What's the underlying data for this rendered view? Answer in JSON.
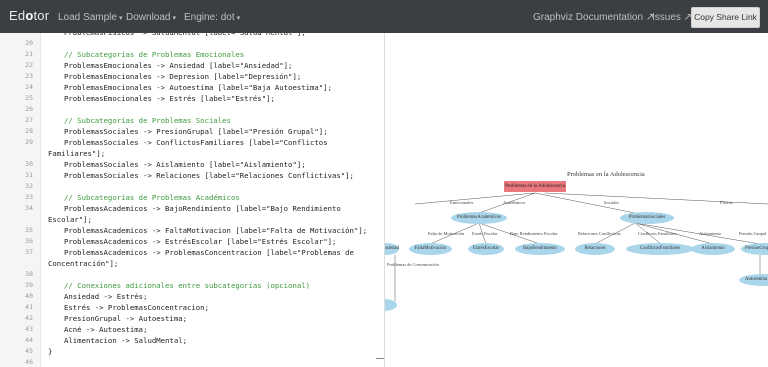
{
  "app": {
    "brand_left": "Ed",
    "brand_mid": "o",
    "brand_right": "tor"
  },
  "nav": {
    "load_sample": "Load Sample",
    "download": "Download",
    "engine": "Engine: dot",
    "graphviz_docs": "Graphviz Documentation ↗",
    "issues": "Issues ↗",
    "copy_share": "Copy Share Link"
  },
  "editor": {
    "lines": [
      {
        "n": "",
        "text": "ProblemasFisicos -> SaludMental [label=\"Salud Mental\"];"
      },
      {
        "n": "20",
        "text": ""
      },
      {
        "n": "21",
        "text": "// Subcategorías de Problemas Emocionales"
      },
      {
        "n": "22",
        "text": "ProblemasEmocionales -> Ansiedad [label=\"Ansiedad\"];"
      },
      {
        "n": "23",
        "text": "ProblemasEmocionales -> Depresion [label=\"Depresión\"];"
      },
      {
        "n": "24",
        "text": "ProblemasEmocionales -> Autoestima [label=\"Baja Autoestima\"];"
      },
      {
        "n": "25",
        "text": "ProblemasEmocionales -> Estrés [label=\"Estrés\"];"
      },
      {
        "n": "26",
        "text": ""
      },
      {
        "n": "27",
        "text": "// Subcategorías de Problemas Sociales"
      },
      {
        "n": "28",
        "text": "ProblemasSociales -> PresionGrupal [label=\"Presión Grupal\"];"
      },
      {
        "n": "29",
        "text": "ProblemasSociales -> ConflictosFamiliares [label=\"Conflictos"
      },
      {
        "n": "",
        "text": "Familiares\"];"
      },
      {
        "n": "30",
        "text": "ProblemasSociales -> Aislamiento [label=\"Aislamiento\"];"
      },
      {
        "n": "31",
        "text": "ProblemasSociales -> Relaciones [label=\"Relaciones Conflictivas\"];"
      },
      {
        "n": "32",
        "text": ""
      },
      {
        "n": "33",
        "text": "// Subcategorías de Problemas Académicos"
      },
      {
        "n": "34",
        "text": "ProblemasAcademicos -> BajoRendimiento [label=\"Bajo Rendimiento"
      },
      {
        "n": "",
        "text": "Escolar\"];"
      },
      {
        "n": "35",
        "text": "ProblemasAcademicos -> FaltaMotivacion [label=\"Falta de Motivación\"];"
      },
      {
        "n": "36",
        "text": "ProblemasAcademicos -> EstrésEscolar [label=\"Estrés Escolar\"];"
      },
      {
        "n": "37",
        "text": "ProblemasAcademicos -> ProblemasConcentracion [label=\"Problemas de"
      },
      {
        "n": "",
        "text": "Concentración\"];"
      },
      {
        "n": "38",
        "text": ""
      },
      {
        "n": "39",
        "text": "// Conexiones adicionales entre subcategorías (opcional)"
      },
      {
        "n": "40",
        "text": "Ansiedad -> Estrés;"
      },
      {
        "n": "41",
        "text": "Estrés -> ProblemasConcentracion;"
      },
      {
        "n": "42",
        "text": "PresionGrupal -> Autoestima;"
      },
      {
        "n": "43",
        "text": "Acné -> Autoestima;"
      },
      {
        "n": "44",
        "text": "Alimentacion -> SaludMental;"
      },
      {
        "n": "45",
        "text": "}"
      },
      {
        "n": "46",
        "text": ""
      }
    ]
  },
  "graph": {
    "title": "Problemas en la Adolescencia",
    "root": "Problemas en la Adolescencia",
    "edge_labels": [
      "Emocionales",
      "Académicos",
      "Sociales",
      "Físicos"
    ],
    "mid_nodes": [
      "ProblemasAcademicos",
      "ProblemasSociales"
    ],
    "sub_edge_labels": [
      "Falta de Motivación",
      "Estrés Escolar",
      "Bajo Rendimiento Escolar",
      "Relaciones Conflictivas",
      "Conflictos Familiares",
      "Aislamiento",
      "Presión Grupal"
    ],
    "leaf_nodes": [
      "FaltaMotivacion",
      "EstrésEscolar",
      "BajoRendimiento",
      "Relaciones",
      "ConflictosFamiliares",
      "Aislamiento",
      "PresionGrupal"
    ],
    "left_partial": "Ansiedad",
    "concentration_label": "Problemas de Concentración",
    "autoestima": "Autoestima"
  },
  "colors": {
    "topbar": "#3b3e42",
    "root_node": "#e9777b",
    "node": "#a9d6ea",
    "comment": "#3d9a3d",
    "string": "#b33a3a"
  }
}
